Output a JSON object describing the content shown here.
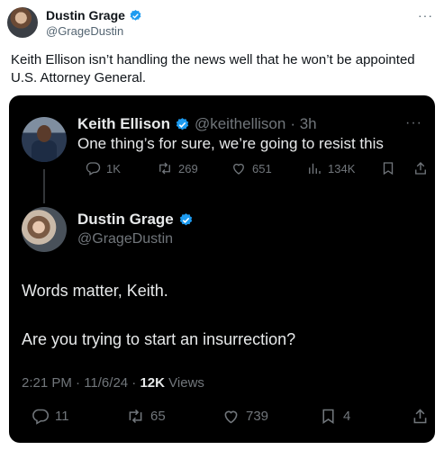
{
  "outer": {
    "name": "Dustin Grage",
    "handle": "@GrageDustin",
    "text": "Keith Ellison isn’t handling the news well that he won’t be appointed U.S. Attorney General.",
    "more": "···"
  },
  "quoted_tweet": {
    "name": "Keith Ellison",
    "handle": "@keithellison",
    "time": "· 3h",
    "text": "One thing’s for sure, we’re going to resist this",
    "more": "···",
    "replies": "1K",
    "reposts": "269",
    "likes": "651",
    "views": "134K"
  },
  "reply_tweet": {
    "name": "Dustin Grage",
    "handle": "@GrageDustin",
    "text_line1": "Words matter, Keith.",
    "text_line2": "Are you trying to start an insurrection?",
    "timestamp": "2:21 PM · 11/6/24 · ",
    "views_count": "12K",
    "views_label": " Views",
    "replies": "11",
    "reposts": "65",
    "likes": "739",
    "bookmarks": "4"
  },
  "colors": {
    "verified": "#1d9bf0",
    "dark_bg": "#000000",
    "muted": "#71767b"
  },
  "icons": [
    "verified-badge-icon",
    "more-icon",
    "reply-icon",
    "repost-icon",
    "like-icon",
    "views-icon",
    "bookmark-icon",
    "share-icon"
  ]
}
